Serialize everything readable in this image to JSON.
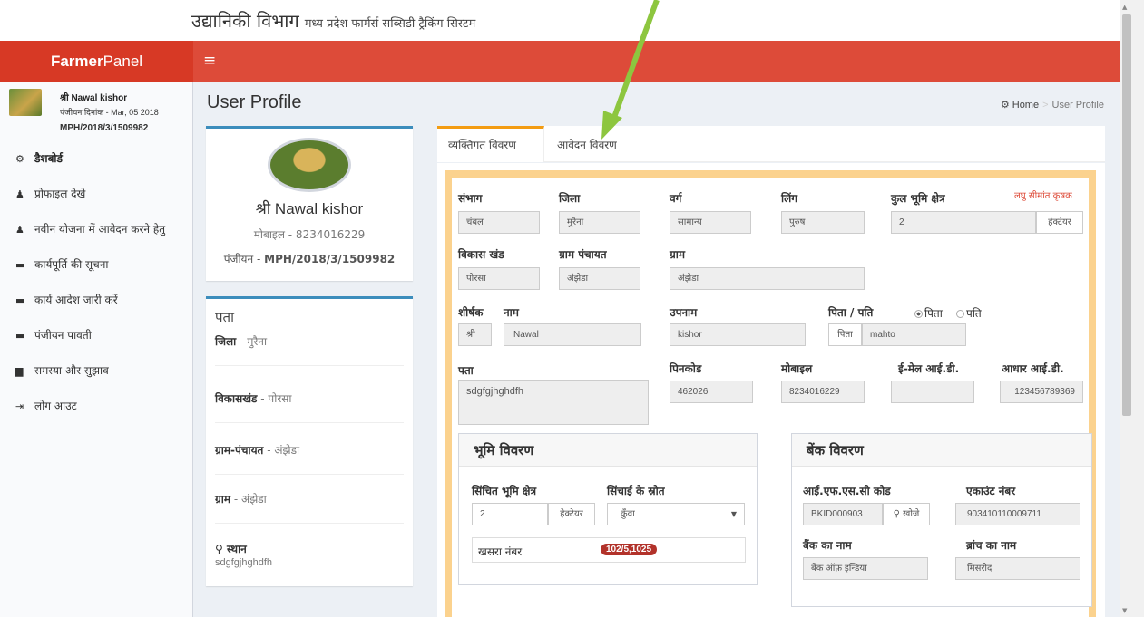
{
  "topbar": {
    "title_main": "उद्यानिकी विभाग",
    "title_sub": "मध्य प्रदेश फार्मर्स सब्सिडी ट्रैकिंग सिस्टम"
  },
  "header": {
    "logo_bold": "Farmer",
    "logo_rest": "Panel",
    "menu_icon": "hamburger-icon"
  },
  "user": {
    "name": "श्री Nawal kishor",
    "reg_date": "पंजीयन दिनांक - Mar, 05 2018",
    "reg_no": "MPH/2018/3/1509982"
  },
  "sidebar": {
    "items": [
      {
        "icon": "dashboard-icon",
        "glyph": "⚙",
        "label": "डैशबोर्ड"
      },
      {
        "icon": "user-icon",
        "glyph": "♟",
        "label": "प्रोफाइल देखे"
      },
      {
        "icon": "user-icon",
        "glyph": "♟",
        "label": "नवीन योजना में आवेदन करने हेतु"
      },
      {
        "icon": "archive-icon",
        "glyph": "▬",
        "label": "कार्यपूर्ति की सूचना"
      },
      {
        "icon": "archive-icon",
        "glyph": "▬",
        "label": "कार्य आदेश जारी करें"
      },
      {
        "icon": "archive-icon",
        "glyph": "▬",
        "label": "पंजीयन पावती"
      },
      {
        "icon": "bar-chart-icon",
        "glyph": "▆",
        "label": "समस्या और सुझाव"
      },
      {
        "icon": "logout-icon",
        "glyph": "⇥",
        "label": "लोग आउट"
      }
    ]
  },
  "content": {
    "title": "User Profile"
  },
  "breadcrumb": {
    "home": "Home",
    "separator": ">",
    "current": "User Profile"
  },
  "profile": {
    "name": "श्री Nawal kishor",
    "mobile": "मोबाइल - 8234016229",
    "reg_label": "पंजीयन - ",
    "reg_value": "MPH/2018/3/1509982"
  },
  "address": {
    "title": "पता",
    "rows": [
      {
        "label": "जिला",
        "value": " - मुरैना"
      },
      {
        "label": "विकासखंड",
        "value": " - पोरसा"
      },
      {
        "label": "ग्राम-पंचायत",
        "value": " - अंझेडा"
      },
      {
        "label": "ग्राम",
        "value": " - अंझेडा"
      }
    ],
    "place_label": "स्थान",
    "place_value": "sdgfgjhghdfh"
  },
  "tabs": {
    "personal": "व्यक्तिगत विवरण",
    "application": "आवेदन विवरण"
  },
  "form": {
    "sambhag": {
      "label": "संभाग",
      "value": "चंबल"
    },
    "jila": {
      "label": "जिला",
      "value": "मुरैना"
    },
    "varg": {
      "label": "वर्ग",
      "value": "सामान्य"
    },
    "ling": {
      "label": "लिंग",
      "value": "पुरुष"
    },
    "land": {
      "label": "कुल भूमि क्षेत्र",
      "value": "2",
      "unit": "हेक्टेयर",
      "hint": "लघु सीमांत कृषक"
    },
    "block": {
      "label": "विकास खंड",
      "value": "पोरसा"
    },
    "panchayat": {
      "label": "ग्राम पंचायत",
      "value": "अंझेडा"
    },
    "gram": {
      "label": "ग्राम",
      "value": "अंझेडा"
    },
    "shirshak": {
      "label": "शीर्षक",
      "value": "श्री"
    },
    "naam": {
      "label": "नाम",
      "value": "Nawal"
    },
    "upnaam": {
      "label": "उपनाम",
      "value": "kishor"
    },
    "pita_pati": {
      "label": "पिता / पति",
      "opt1": "पिता",
      "opt2": "पति",
      "prefix": "पिता",
      "value": "mahto"
    },
    "pata": {
      "label": "पता",
      "value": "sdgfgjhghdfh"
    },
    "pincode": {
      "label": "पिनकोड",
      "value": "462026"
    },
    "mobile": {
      "label": "मोबाइल",
      "value": "8234016229"
    },
    "email": {
      "label": "ई-मेल आई.डी.",
      "value": ""
    },
    "aadhar": {
      "label": "आधार आई.डी.",
      "value": "123456789369"
    }
  },
  "land_box": {
    "title": "भूमि विवरण",
    "irrigated_label": "सिंचित भूमि क्षेत्र",
    "irrigated_value": "2",
    "irrigated_unit": "हेक्टेयर",
    "source_label": "सिंचाई के स्रोत",
    "source_value": "कुँवा",
    "khasra_label": "खसरा नंबर",
    "khasra_value": "102/5,1025"
  },
  "bank_box": {
    "title": "बेंक विवरण",
    "ifsc_label": "आई.एफ.एस.सी कोड",
    "ifsc_value": "BKID000903",
    "search_label": "खोजे",
    "account_label": "एकाउंट नंबर",
    "account_value": "903410110009711",
    "bank_label": "बैंक का नाम",
    "bank_value": "बैंक ऑफ़ इन्डिया",
    "branch_label": "ब्रांच का नाम",
    "branch_value": "मिसरोद"
  },
  "colors": {
    "header_red": "#dd4b39",
    "logo_red": "#d73925",
    "tab_accent": "#f39c12",
    "panel_border": "#fbd28e",
    "arrow_green": "#8dc63f"
  }
}
